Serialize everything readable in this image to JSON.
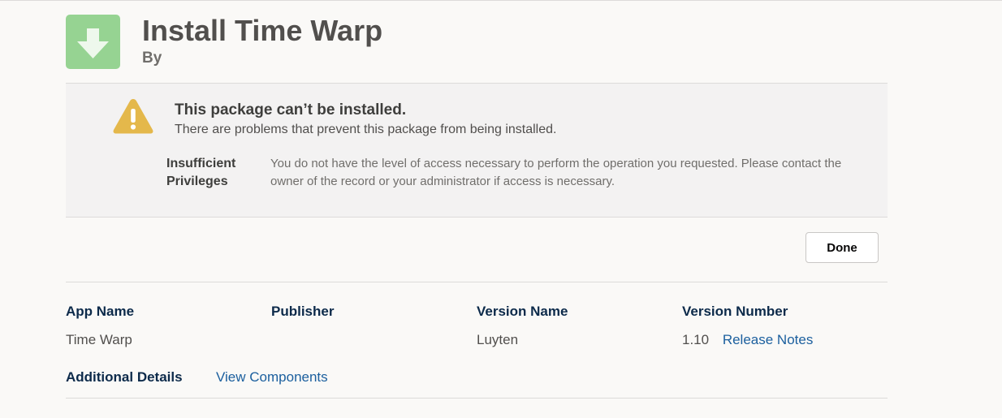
{
  "header": {
    "title": "Install Time Warp",
    "byline": "By",
    "icon": "download-arrow-icon",
    "icon_color": "#96d392"
  },
  "error": {
    "icon": "warning-icon",
    "icon_color": "#e4b84b",
    "title": "This package can’t be installed.",
    "subtitle": "There are problems that prevent this package from being installed.",
    "label": "Insufficient Privileges",
    "message": "You do not have the level of access necessary to perform the operation you requested. Please contact the owner of the record or your administrator if access is necessary."
  },
  "actions": {
    "done_label": "Done"
  },
  "details": {
    "app_name_label": "App Name",
    "app_name_value": "Time Warp",
    "publisher_label": "Publisher",
    "publisher_value": "",
    "version_name_label": "Version Name",
    "version_name_value": "Luyten",
    "version_number_label": "Version Number",
    "version_number_value": "1.10",
    "release_notes_link": "Release Notes",
    "additional_details_label": "Additional Details",
    "view_components_link": "View Components"
  },
  "colors": {
    "link": "#1b5f9e",
    "label": "#0c2a4a",
    "background": "#faf9f7"
  }
}
